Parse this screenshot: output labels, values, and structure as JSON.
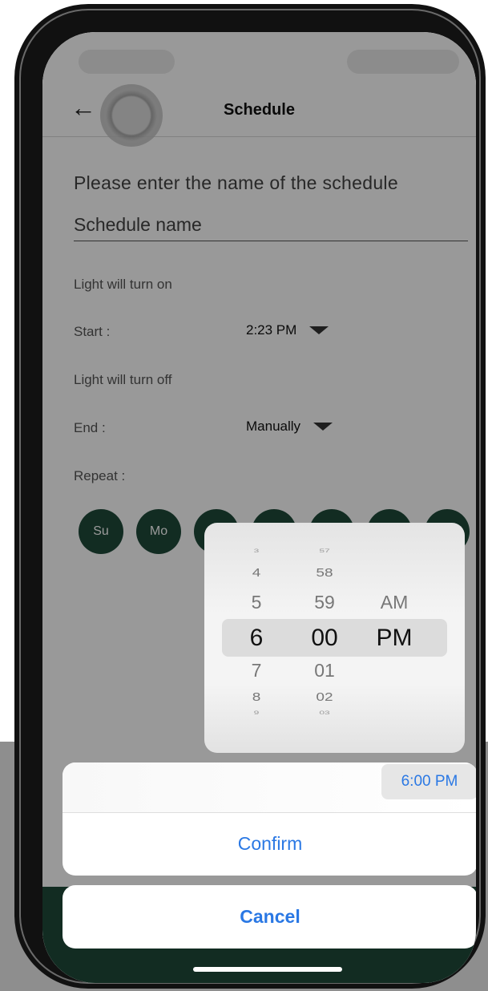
{
  "header": {
    "title": "Schedule",
    "back_icon": "←"
  },
  "form": {
    "prompt": "Please enter the name of the schedule",
    "name_placeholder": "Schedule name",
    "on_heading": "Light will turn on",
    "start_label": "Start :",
    "start_value": "2:23 PM",
    "off_heading": "Light will turn off",
    "end_label": "End :",
    "end_value": "Manually",
    "repeat_label": "Repeat :",
    "days": [
      "Su",
      "Mo",
      "",
      "",
      "",
      "",
      ""
    ]
  },
  "picker": {
    "hours": [
      "3",
      "4",
      "5",
      "6",
      "7",
      "8",
      "9"
    ],
    "minutes": [
      "57",
      "58",
      "59",
      "00",
      "01",
      "02",
      "03"
    ],
    "periods": [
      "AM",
      "PM"
    ],
    "selected": {
      "hour": "6",
      "minute": "00",
      "period": "PM"
    }
  },
  "sheet": {
    "selected_time": "6:00 PM",
    "confirm_label": "Confirm",
    "cancel_label": "Cancel"
  },
  "colors": {
    "accent_green": "#1f4a3a",
    "ios_blue": "#2a78e4"
  }
}
